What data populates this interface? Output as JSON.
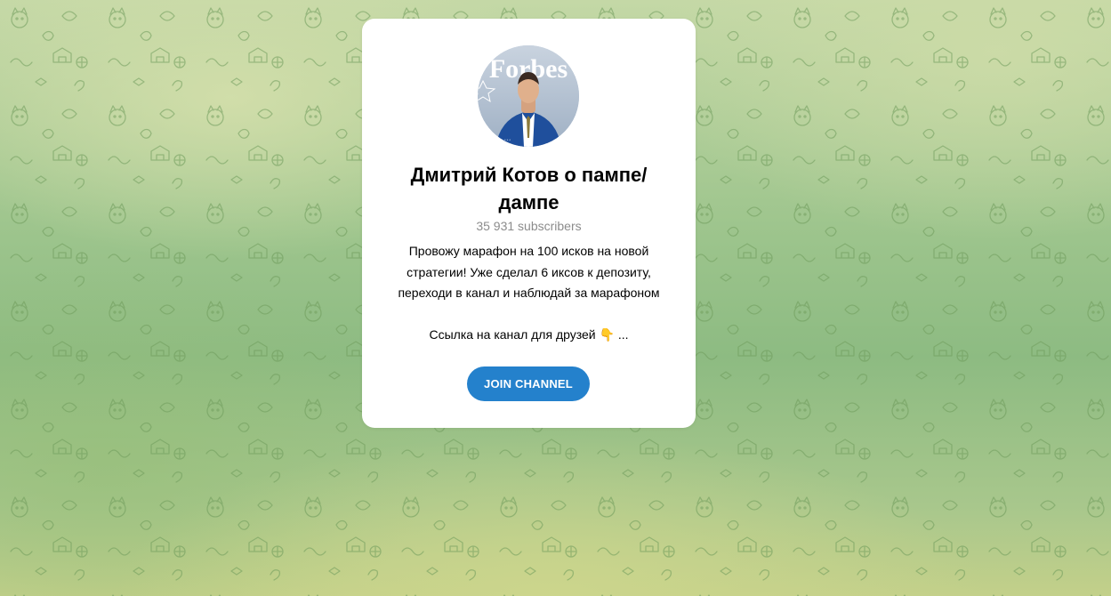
{
  "channel": {
    "title": "Дмитрий Котов о пампе/ дампе",
    "subscribers": "35 931 subscribers",
    "description_lines": [
      "Провожу марафон на 100 исков на новой стратегии! Уже сделал 6 иксов к депозиту, переходи в канал и наблюдай за марафоном",
      "Ссылка на канал для друзей 👇 ..."
    ],
    "avatar_text": "Forbes",
    "join_label": "JOIN CHANNEL"
  },
  "background": {
    "pattern_icon": "doodle-pattern-icon"
  },
  "colors": {
    "accent": "#2481cc",
    "card": "#ffffff",
    "subtitle": "#8c8c8c"
  }
}
